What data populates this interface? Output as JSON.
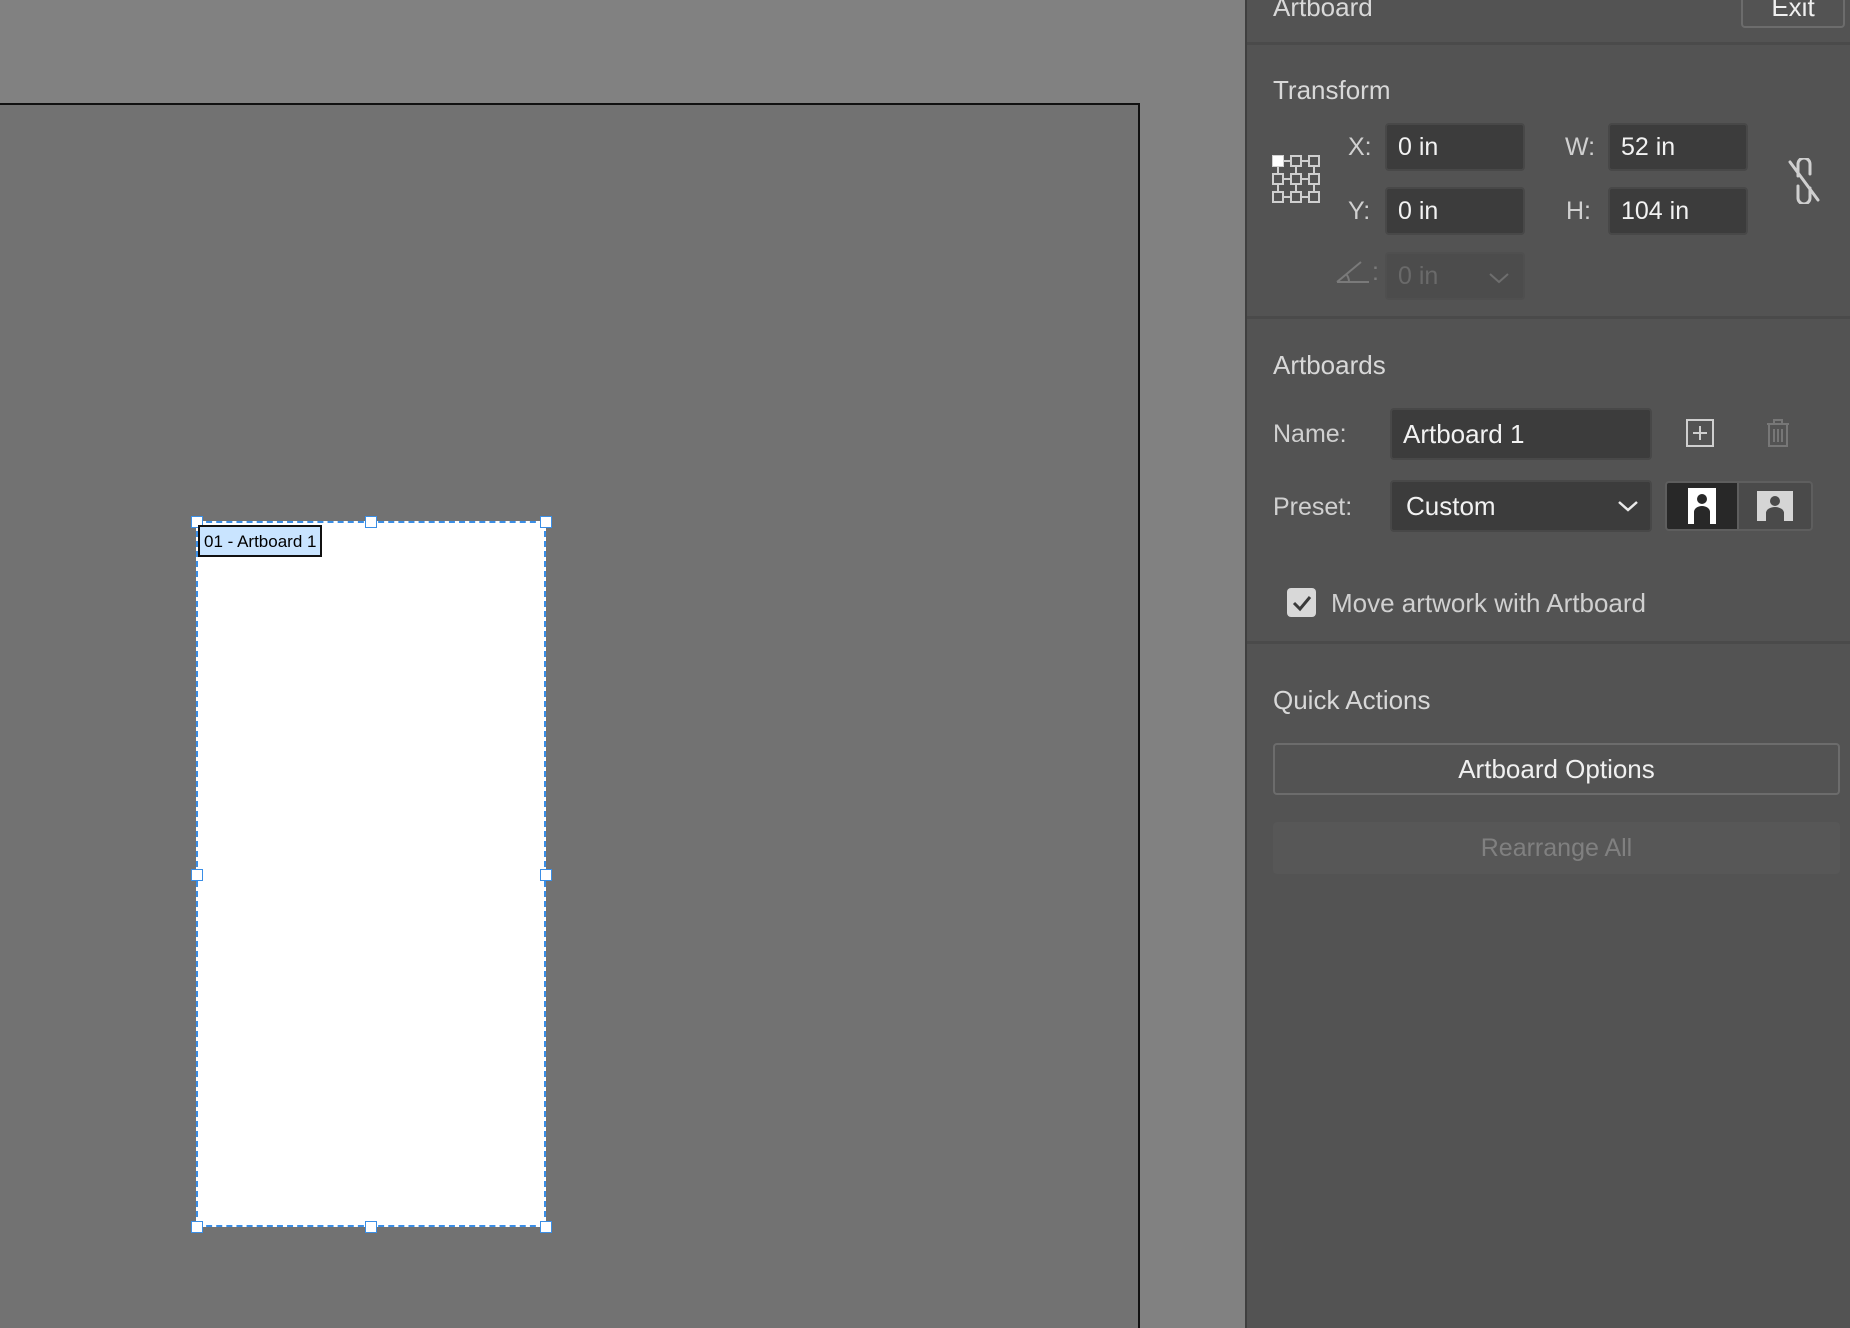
{
  "artboard": {
    "label": "01 - Artboard 1"
  },
  "panel": {
    "title": "Artboard",
    "exit_label": "Exit",
    "transform": {
      "title": "Transform",
      "x_label": "X:",
      "x_value": "0 in",
      "y_label": "Y:",
      "y_value": "0 in",
      "w_label": "W:",
      "w_value": "52 in",
      "h_label": "H:",
      "h_value": "104 in",
      "angle_label": ":",
      "angle_value": "0 in"
    },
    "artboards": {
      "title": "Artboards",
      "name_label": "Name:",
      "name_value": "Artboard 1",
      "preset_label": "Preset:",
      "preset_value": "Custom",
      "move_artwork_label": "Move artwork with Artboard",
      "move_artwork_checked": true
    },
    "quick_actions": {
      "title": "Quick Actions",
      "artboard_options": "Artboard Options",
      "rearrange_all": "Rearrange All"
    }
  },
  "colors": {
    "selection": "#3a8ee6",
    "panel_bg": "#535353",
    "canvas_bg": "#727272"
  },
  "icons": [
    "reference-point-icon",
    "link-proportions-icon",
    "angle-icon",
    "chevron-down-icon",
    "new-artboard-icon",
    "delete-artboard-icon",
    "portrait-icon",
    "landscape-icon",
    "checkbox-check-icon"
  ]
}
